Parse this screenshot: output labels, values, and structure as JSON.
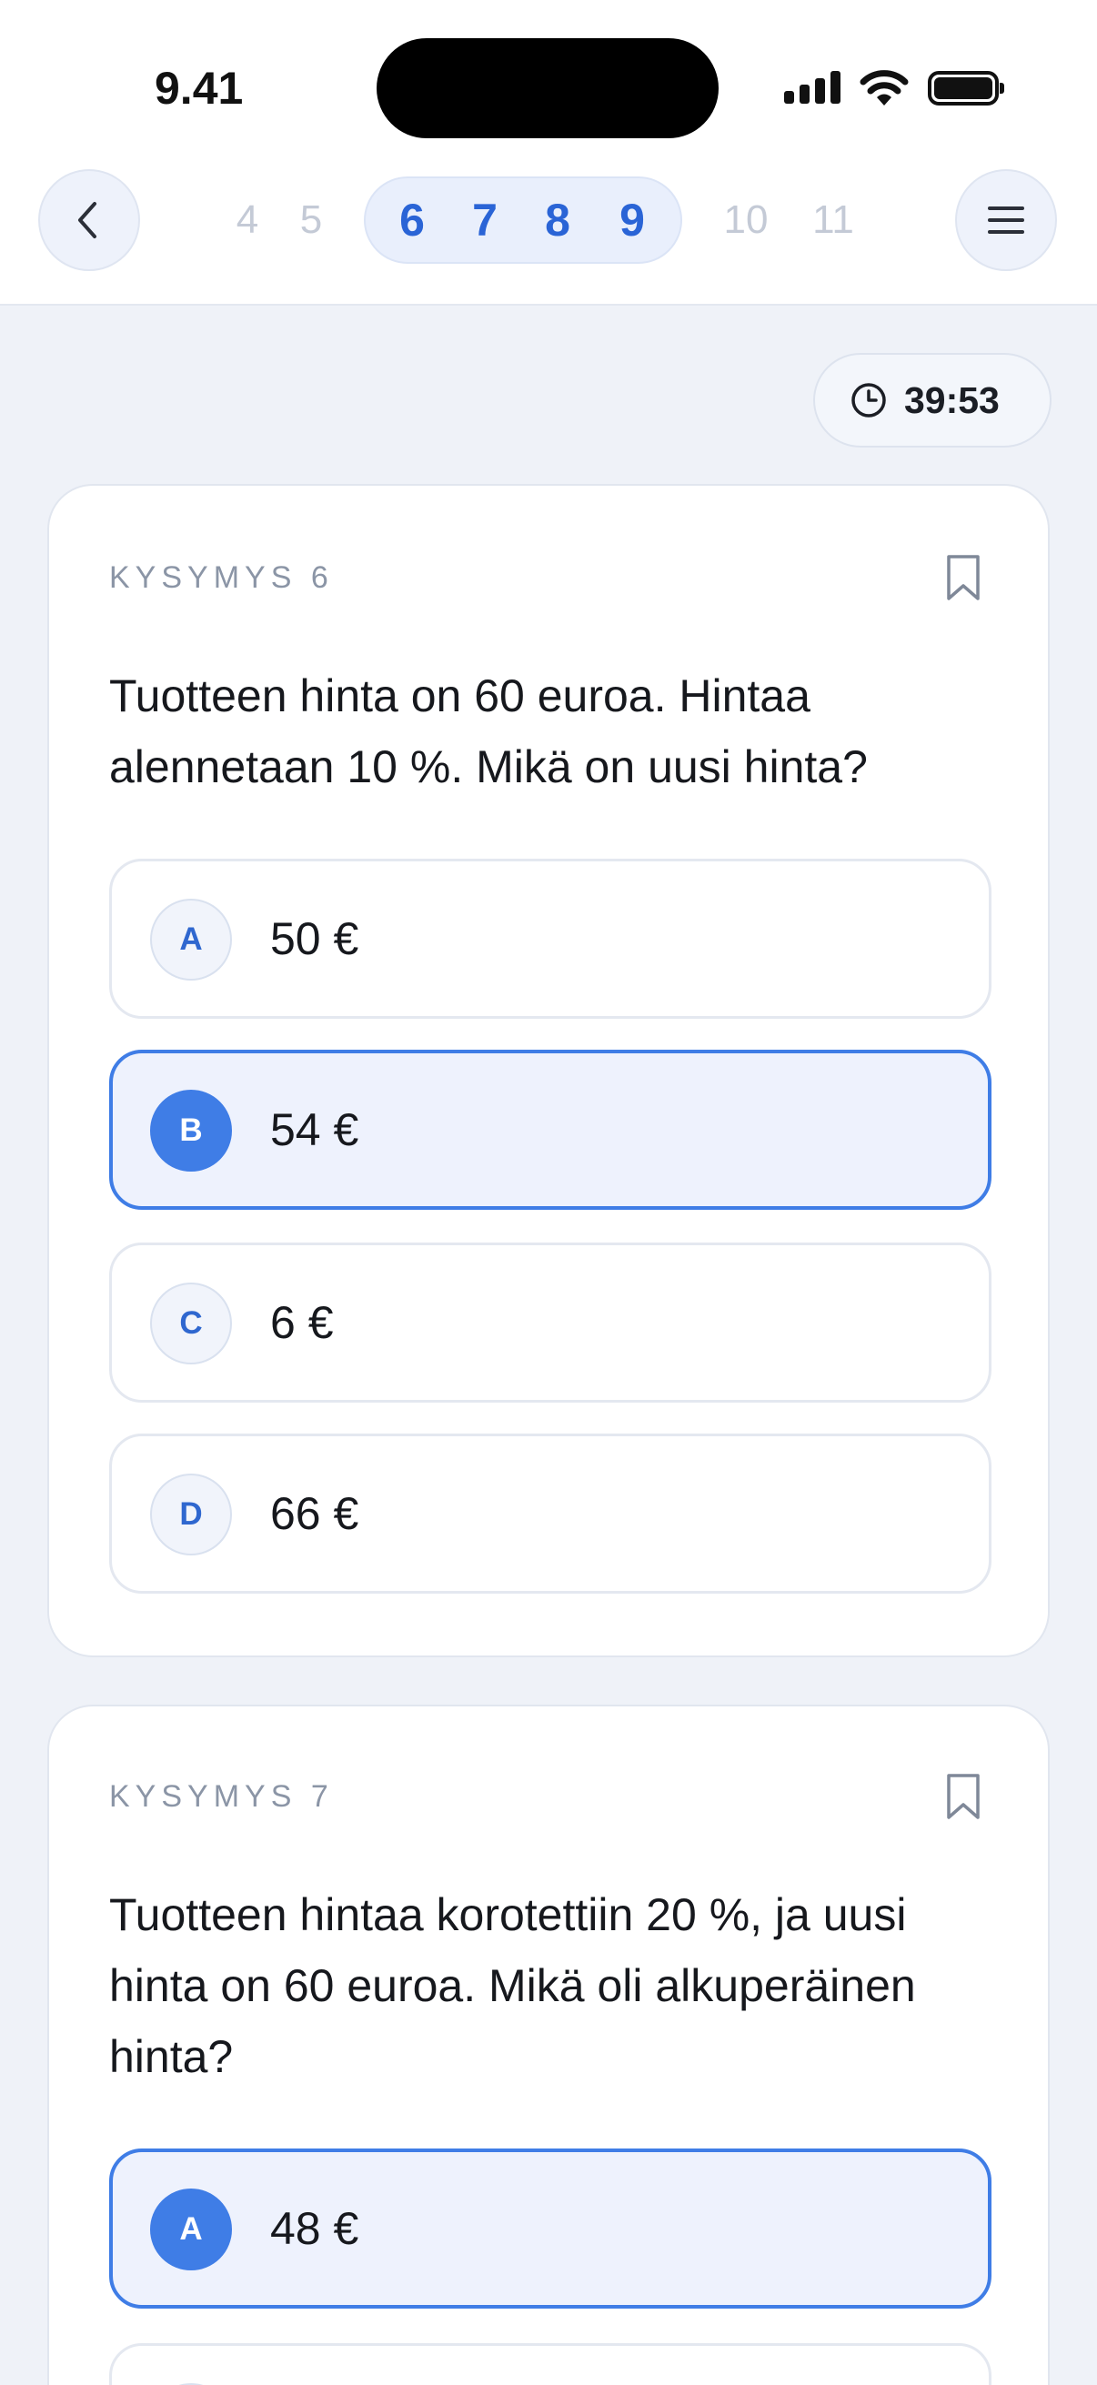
{
  "status_bar": {
    "time": "9.41"
  },
  "nav": {
    "pages_before": [
      "4",
      "5"
    ],
    "pages_current": [
      "6",
      "7",
      "8",
      "9"
    ],
    "pages_after": [
      "10",
      "11"
    ]
  },
  "timer": {
    "text": "39:53"
  },
  "questions": [
    {
      "label": "KYSYMYS 6",
      "text": "Tuotteen hinta on 60 euroa. Hintaa alennetaan 10 %. Mikä on uusi hinta?",
      "options": [
        {
          "letter": "A",
          "text": "50 €",
          "selected": false
        },
        {
          "letter": "B",
          "text": "54 €",
          "selected": true
        },
        {
          "letter": "C",
          "text": "6 €",
          "selected": false
        },
        {
          "letter": "D",
          "text": "66 €",
          "selected": false
        }
      ]
    },
    {
      "label": "KYSYMYS 7",
      "text": "Tuotteen hintaa korotettiin 20 %, ja uusi hinta on 60 euroa. Mikä oli alkuperäinen hinta?",
      "options": [
        {
          "letter": "A",
          "text": "48 €",
          "selected": true
        }
      ]
    }
  ],
  "icons": {
    "back": "chevron-left-icon",
    "menu": "hamburger-menu-icon",
    "timer": "clock-icon",
    "bookmark": "bookmark-icon"
  },
  "colors": {
    "accent": "#3f7de6",
    "page_current": "#2a64d6",
    "page_inactive": "#c4cad6",
    "background": "#eff2f8"
  }
}
